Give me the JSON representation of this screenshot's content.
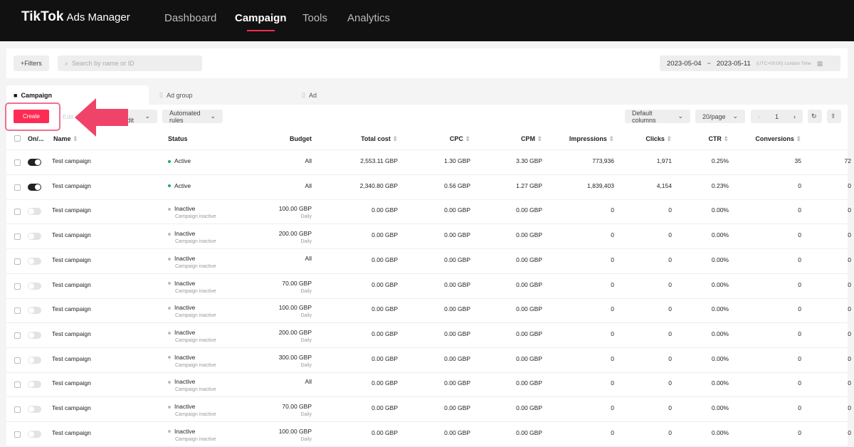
{
  "header": {
    "logo": "TikTok",
    "logo_suffix": "Ads Manager",
    "nav": [
      "Dashboard",
      "Campaign",
      "Tools",
      "Analytics"
    ],
    "active_nav": "Campaign"
  },
  "filters": {
    "filters_label": "+Filters",
    "search_placeholder": "Search by name or ID",
    "date_start": "2023-05-04",
    "date_sep": "~",
    "date_end": "2023-05-11",
    "timezone": "(UTC+00:00) London Time"
  },
  "tabs": [
    "Campaign",
    "Ad group",
    "Ad"
  ],
  "toolbar": {
    "create": "Create",
    "edit": "Edit",
    "bulk": "Bulk create/Edit",
    "rules": "Automated rules",
    "columns": "Default columns",
    "per_page": "20/page",
    "page": "1"
  },
  "accent": "#fe2c55",
  "columns": [
    "On/...",
    "Name",
    "Status",
    "Budget",
    "Total cost",
    "CPC",
    "CPM",
    "Impressions",
    "Clicks",
    "CTR",
    "Conversions"
  ],
  "rows": [
    {
      "on": true,
      "name": "Test campaign",
      "status": "Active",
      "status_sub": "",
      "budget": "All",
      "budget_sub": "",
      "cost": "2,553.11 GBP",
      "cpc": "1.30 GBP",
      "cpm": "3.30 GBP",
      "impr": "773,936",
      "clicks": "1,971",
      "ctr": "0.25%",
      "conv": "35",
      "extra": "72"
    },
    {
      "on": true,
      "name": "Test campaign",
      "status": "Active",
      "status_sub": "",
      "budget": "All",
      "budget_sub": "",
      "cost": "2,340.80 GBP",
      "cpc": "0.56 GBP",
      "cpm": "1.27 GBP",
      "impr": "1,839,403",
      "clicks": "4,154",
      "ctr": "0.23%",
      "conv": "0",
      "extra": "0"
    },
    {
      "on": false,
      "name": "Test campaign",
      "status": "Inactive",
      "status_sub": "Campaign inactive",
      "budget": "100.00 GBP",
      "budget_sub": "Daily",
      "cost": "0.00 GBP",
      "cpc": "0.00 GBP",
      "cpm": "0.00 GBP",
      "impr": "0",
      "clicks": "0",
      "ctr": "0.00%",
      "conv": "0",
      "extra": "0"
    },
    {
      "on": false,
      "name": "Test campaign",
      "status": "Inactive",
      "status_sub": "Campaign inactive",
      "budget": "200.00 GBP",
      "budget_sub": "Daily",
      "cost": "0.00 GBP",
      "cpc": "0.00 GBP",
      "cpm": "0.00 GBP",
      "impr": "0",
      "clicks": "0",
      "ctr": "0.00%",
      "conv": "0",
      "extra": "0"
    },
    {
      "on": false,
      "name": "Test campaign",
      "status": "Inactive",
      "status_sub": "Campaign inactive",
      "budget": "All",
      "budget_sub": "",
      "cost": "0.00 GBP",
      "cpc": "0.00 GBP",
      "cpm": "0.00 GBP",
      "impr": "0",
      "clicks": "0",
      "ctr": "0.00%",
      "conv": "0",
      "extra": "0"
    },
    {
      "on": false,
      "name": "Test campaign",
      "status": "Inactive",
      "status_sub": "Campaign inactive",
      "budget": "70.00 GBP",
      "budget_sub": "Daily",
      "cost": "0.00 GBP",
      "cpc": "0.00 GBP",
      "cpm": "0.00 GBP",
      "impr": "0",
      "clicks": "0",
      "ctr": "0.00%",
      "conv": "0",
      "extra": "0"
    },
    {
      "on": false,
      "name": "Test campaign",
      "status": "Inactive",
      "status_sub": "Campaign inactive",
      "budget": "100.00 GBP",
      "budget_sub": "Daily",
      "cost": "0.00 GBP",
      "cpc": "0.00 GBP",
      "cpm": "0.00 GBP",
      "impr": "0",
      "clicks": "0",
      "ctr": "0.00%",
      "conv": "0",
      "extra": "0"
    },
    {
      "on": false,
      "name": "Test campaign",
      "status": "Inactive",
      "status_sub": "Campaign inactive",
      "budget": "200.00 GBP",
      "budget_sub": "Daily",
      "cost": "0.00 GBP",
      "cpc": "0.00 GBP",
      "cpm": "0.00 GBP",
      "impr": "0",
      "clicks": "0",
      "ctr": "0.00%",
      "conv": "0",
      "extra": "0"
    },
    {
      "on": false,
      "name": "Test campaign",
      "status": "Inactive",
      "status_sub": "Campaign inactive",
      "budget": "300.00 GBP",
      "budget_sub": "Daily",
      "cost": "0.00 GBP",
      "cpc": "0.00 GBP",
      "cpm": "0.00 GBP",
      "impr": "0",
      "clicks": "0",
      "ctr": "0.00%",
      "conv": "0",
      "extra": "0"
    },
    {
      "on": false,
      "name": "Test campaign",
      "status": "Inactive",
      "status_sub": "Campaign inactive",
      "budget": "All",
      "budget_sub": "",
      "cost": "0.00 GBP",
      "cpc": "0.00 GBP",
      "cpm": "0.00 GBP",
      "impr": "0",
      "clicks": "0",
      "ctr": "0.00%",
      "conv": "0",
      "extra": "0"
    },
    {
      "on": false,
      "name": "Test campaign",
      "status": "Inactive",
      "status_sub": "Campaign inactive",
      "budget": "70.00 GBP",
      "budget_sub": "Daily",
      "cost": "0.00 GBP",
      "cpc": "0.00 GBP",
      "cpm": "0.00 GBP",
      "impr": "0",
      "clicks": "0",
      "ctr": "0.00%",
      "conv": "0",
      "extra": "0"
    },
    {
      "on": false,
      "name": "Test campaign",
      "status": "Inactive",
      "status_sub": "Campaign inactive",
      "budget": "100.00 GBP",
      "budget_sub": "Daily",
      "cost": "0.00 GBP",
      "cpc": "0.00 GBP",
      "cpm": "0.00 GBP",
      "impr": "0",
      "clicks": "0",
      "ctr": "0.00%",
      "conv": "0",
      "extra": "0"
    }
  ]
}
